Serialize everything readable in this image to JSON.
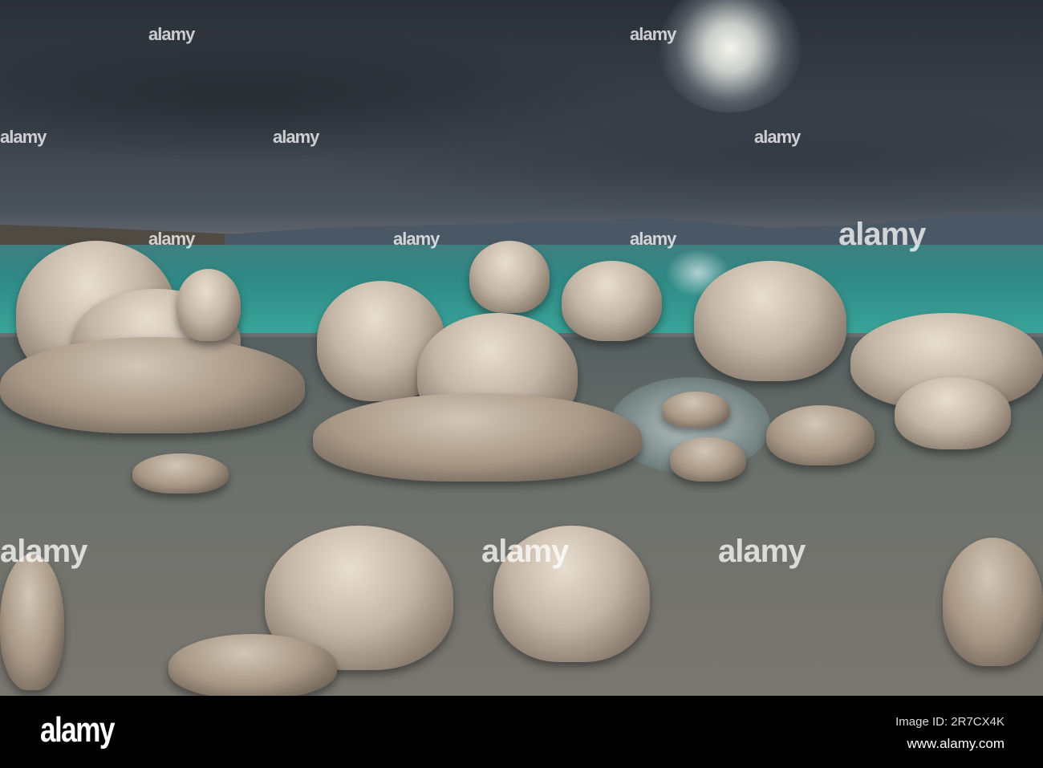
{
  "watermark": {
    "text": "alamy"
  },
  "footer": {
    "logo": "alamy",
    "image_id": "Image ID: 2R7CX4K",
    "url": "www.alamy.com"
  }
}
